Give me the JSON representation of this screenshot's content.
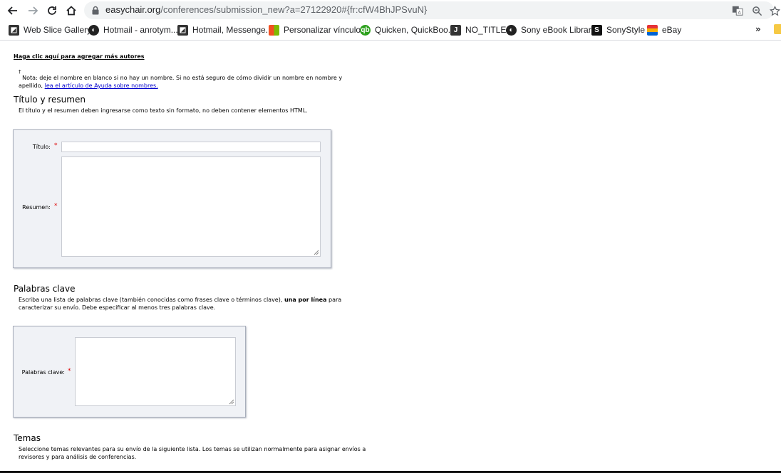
{
  "browser": {
    "url_host": "easychair.org",
    "url_path": "/conferences/submission_new?a=27122920#{fr:cfW4BhJPSvuN}",
    "bookmarks": [
      {
        "label": "Web Slice Gallery",
        "icon": "web-slice-icon"
      },
      {
        "label": "Hotmail - anrotym...",
        "icon": "globe-icon"
      },
      {
        "label": "Hotmail, Messenge...",
        "icon": "web-slice-icon"
      },
      {
        "label": "Personalizar vínculos",
        "icon": "microsoft-icon"
      },
      {
        "label": "Quicken, QuickBoo...",
        "icon": "quickbooks-icon"
      },
      {
        "label": "NO_TITLE",
        "icon": "j-icon"
      },
      {
        "label": "Sony eBook Library",
        "icon": "globe-icon"
      },
      {
        "label": "SonyStyle",
        "icon": "s-icon"
      },
      {
        "label": "eBay",
        "icon": "gift-icon"
      }
    ],
    "more_label": "»"
  },
  "authors": {
    "add_more_link": "Haga clic aquí para agregar más autores",
    "dagger": "†",
    "note": "Nota: deje el nombre en blanco si no hay un nombre. Si no está seguro de cómo dividir un nombre en nombre y apellido,",
    "help_link": "lea el artículo de Ayuda sobre nombres."
  },
  "title_section": {
    "heading": "Título y resumen",
    "description": "El título y el resumen deben ingresarse como texto sin formato, no deben contener elementos HTML.",
    "title_label": "Título:",
    "abstract_label": "Resumen:",
    "title_value": "",
    "abstract_value": ""
  },
  "keywords_section": {
    "heading": "Palabras clave",
    "description_pre": "Escriba una lista de palabras clave (también conocidas como frases clave o términos clave),",
    "description_bold": "una por línea",
    "description_post": "para caracterizar su envío. Debe especificar al menos tres palabras clave.",
    "label": "Palabras clave:",
    "value": ""
  },
  "topics_section": {
    "heading": "Temas",
    "description": "Seleccione temas relevantes para su envío de la siguiente lista. Los temas se utilizan normalmente para asignar envíos a revisores y para análisis de conferencias."
  },
  "required_mark": "*",
  "colors": {
    "form_bg": "#f0f2f6",
    "form_border": "#a8aebb",
    "required": "#dd0000",
    "link": "#0000cc"
  }
}
